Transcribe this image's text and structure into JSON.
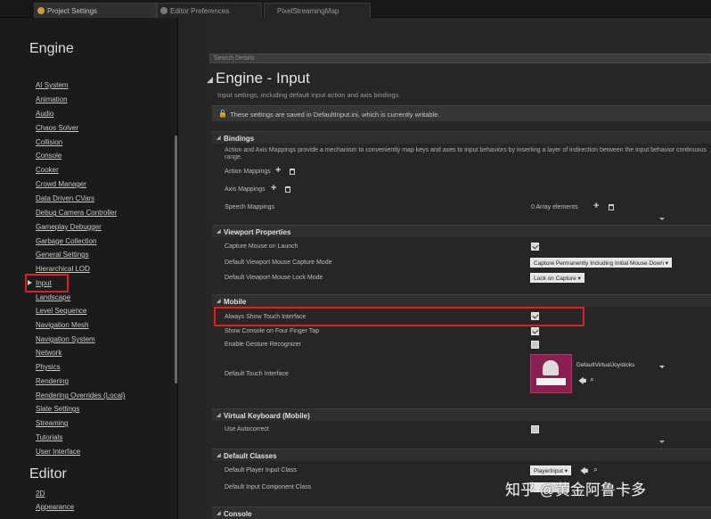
{
  "tabs": [
    {
      "label": "Project Settings",
      "active": true
    },
    {
      "label": "Editor Preferences",
      "active": false
    },
    {
      "label": "PixelStreamingMap",
      "active": false
    }
  ],
  "sidebar": {
    "engine_heading": "Engine",
    "editor_heading": "Editor",
    "items": [
      "AI System",
      "Animation",
      "Audio",
      "Chaos Solver",
      "Collision",
      "Console",
      "Cooker",
      "Crowd Manager",
      "Data Driven CVars",
      "Debug Camera Controller",
      "Gameplay Debugger",
      "Garbage Collection",
      "General Settings",
      "Hierarchical LOD",
      "Input",
      "Landscape",
      "Level Sequence",
      "Navigation Mesh",
      "Navigation System",
      "Network",
      "Physics",
      "Rendering",
      "Rendering Overrides (Local)",
      "Slate Settings",
      "Streaming",
      "Tutorials",
      "User Interface"
    ],
    "selected": "Input",
    "editor_items": [
      "2D",
      "Appearance"
    ]
  },
  "details": {
    "search_placeholder": "Search Details",
    "title": "Engine - Input",
    "subtitle": "Input settings, including default input action and axis bindings.",
    "notice": "These settings are saved in DefaultInput.ini, which is currently writable.",
    "bindings": {
      "header": "Bindings",
      "description": "Action and Axis Mappings provide a mechanism to conveniently map keys and axes to input behaviors by inserting a layer of indirection between the input behavior continuous range.",
      "action_mappings": "Action Mappings",
      "axis_mappings": "Axis Mappings",
      "speech_mappings": "Speech Mappings",
      "speech_value": "0 Array elements"
    },
    "viewport": {
      "header": "Viewport Properties",
      "capture_mouse_label": "Capture Mouse on Launch",
      "capture_mouse_checked": true,
      "capture_mode_label": "Default Viewport Mouse Capture Mode",
      "capture_mode_value": "Capture Permanently Including Initial Mouse Down",
      "lock_mode_label": "Default Viewport Mouse Lock Mode",
      "lock_mode_value": "Lock on Capture"
    },
    "mobile": {
      "header": "Mobile",
      "always_show_label": "Always Show Touch Interface",
      "always_show_checked": true,
      "show_console_label": "Show Console on Four Finger Tap",
      "show_console_checked": true,
      "gesture_label": "Enable Gesture Recognizer",
      "gesture_checked": false,
      "touch_interface_label": "Default Touch Interface",
      "touch_interface_value": "DefaultVirtualJoysticks"
    },
    "virtual_keyboard": {
      "header": "Virtual Keyboard (Mobile)",
      "autocorrect_label": "Use Autocorrect",
      "autocorrect_checked": false
    },
    "default_classes": {
      "header": "Default Classes",
      "player_input_label": "Default Player Input Class",
      "player_input_value": "PlayerInput",
      "component_label": "Default Input Component Class"
    },
    "console_header": "Console"
  },
  "watermark": "知乎 @黄金阿鲁卡多",
  "colors": {
    "highlight": "#e02020",
    "thumbnail": "#8a2050"
  }
}
